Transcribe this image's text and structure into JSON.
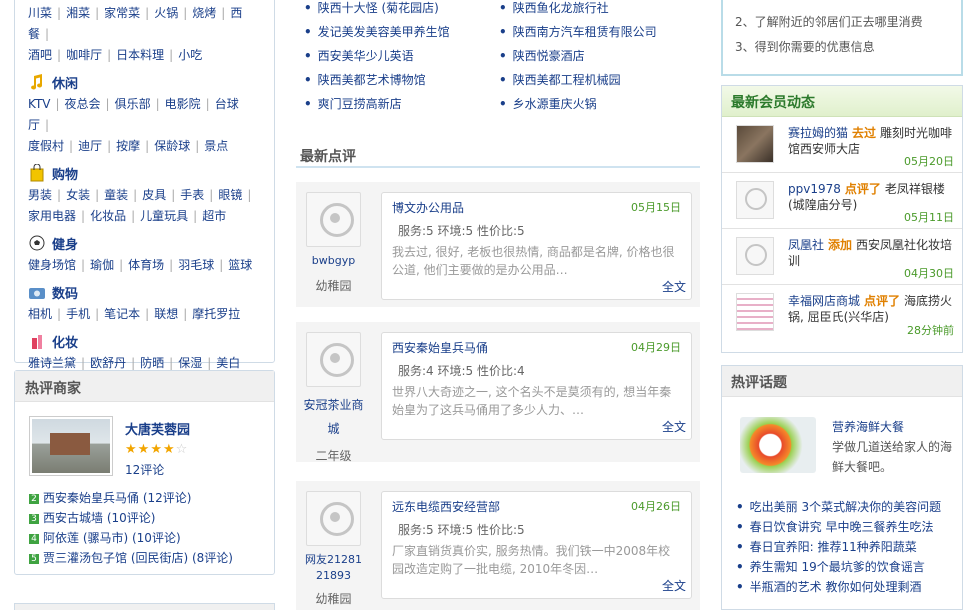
{
  "categories": [
    {
      "title": "",
      "icon": "",
      "links": [
        [
          "川菜",
          "湘菜",
          "家常菜",
          "火锅",
          "烧烤",
          "西餐"
        ],
        [
          "酒吧",
          "咖啡厅",
          "日本料理",
          "小吃"
        ]
      ]
    },
    {
      "title": "休闲",
      "icon": "music-note-icon",
      "links": [
        [
          "KTV",
          "夜总会",
          "俱乐部",
          "电影院",
          "台球厅"
        ],
        [
          "度假村",
          "迪厅",
          "按摩",
          "保龄球",
          "景点"
        ]
      ]
    },
    {
      "title": "购物",
      "icon": "shopping-bag-icon",
      "links": [
        [
          "男装",
          "女装",
          "童装",
          "皮具",
          "手表",
          "眼镜"
        ],
        [
          "家用电器",
          "化妆品",
          "儿童玩具",
          "超市"
        ]
      ]
    },
    {
      "title": "健身",
      "icon": "soccer-ball-icon",
      "links": [
        [
          "健身场馆",
          "瑜伽",
          "体育场",
          "羽毛球",
          "篮球"
        ]
      ]
    },
    {
      "title": "数码",
      "icon": "camera-icon",
      "links": [
        [
          "相机",
          "手机",
          "笔记本",
          "联想",
          "摩托罗拉"
        ]
      ]
    },
    {
      "title": "化妆",
      "icon": "cosmetics-icon",
      "links": [
        [
          "雅诗兰黛",
          "欧舒丹",
          "防晒",
          "保湿",
          "美白"
        ]
      ]
    }
  ],
  "hot_merchants": {
    "title": "热评商家",
    "featured": {
      "name": "大唐芙蓉园",
      "stars": 4,
      "count": "12评论"
    },
    "list": [
      {
        "rank": "2",
        "text": "西安秦始皇兵马俑 (12评论)"
      },
      {
        "rank": "3",
        "text": "西安古城墙 (10评论)"
      },
      {
        "rank": "4",
        "text": "阿依莲 (骡马市) (10评论)"
      },
      {
        "rank": "5",
        "text": "贾三灌汤包子馆 (回民街店) (8评论)"
      }
    ]
  },
  "top_links": [
    "陕西十大怪 (菊花园店)",
    "陕西鱼化龙旅行社",
    "发记美发美容美甲养生馆",
    "陕西南方汽车租赁有限公司",
    "西安美华少儿英语",
    "陕西悦豪酒店",
    "陕西美都艺术博物馆",
    "陕西美都工程机械园",
    "爽门豆捞高新店",
    "乡水源重庆火锅"
  ],
  "reviews": {
    "title": "最新点评",
    "items": [
      {
        "user": "bwbgyp",
        "level": "幼稚园",
        "merchant": "博文办公用品",
        "date": "05月15日",
        "scores": "服务:5  环境:5  性价比:5",
        "excerpt": "我去过, 很好, 老板也很热情, 商品都是名牌, 价格也很公道, 他们主要做的是办公用品…",
        "full": "全文"
      },
      {
        "user": "安冠茶业商城",
        "level": "二年级",
        "merchant": "西安秦始皇兵马俑",
        "date": "04月29日",
        "scores": "服务:4  环境:5  性价比:4",
        "excerpt": "世界八大奇迹之一, 这个名头不是莫须有的, 想当年秦始皇为了这兵马俑用了多少人力、…",
        "full": "全文"
      },
      {
        "user": "网友2128121893",
        "level": "幼稚园",
        "merchant": "远东电缆西安经营部",
        "date": "04月26日",
        "scores": "服务:5  环境:5  性价比:5",
        "excerpt": "厂家直销货真价实, 服务热情。我们铁一中2008年校园改造定购了一批电缆, 2010年冬因…",
        "full": "全文"
      }
    ]
  },
  "tips": [
    "2、了解附近的邻居们正去哪里消费",
    "3、得到你需要的优惠信息"
  ],
  "member_activity": {
    "title": "最新会员动态",
    "items": [
      {
        "user": "赛拉姆的猫",
        "action": "去过",
        "target": "雕刻时光咖啡馆西安师大店",
        "date": "05月20日"
      },
      {
        "user": "ppv1978",
        "action": "点评了",
        "target": "老凤祥银楼(城隍庙分号)",
        "date": "05月11日"
      },
      {
        "user": "凤凰社",
        "action": "添加",
        "target": "西安凤凰社化妆培训",
        "date": "04月30日"
      },
      {
        "user": "幸福网店商城",
        "action": "点评了",
        "target": "海底捞火锅, 屈臣氏(兴华店)",
        "date": "28分钟前"
      }
    ]
  },
  "hot_topics": {
    "title": "热评话题",
    "featured": {
      "title": "营养海鲜大餐",
      "desc": "学做几道送给家人的海鲜大餐吧。"
    },
    "list": [
      "吃出美丽 3个菜式解决你的美容问题",
      "春日饮食讲究 早中晚三餐养生吃法",
      "春日宜养阳: 推荐11种养阳蔬菜",
      "养生需知 19个最坑爹的饮食谣言",
      "半瓶酒的艺术 教你如何处理剩酒"
    ]
  }
}
